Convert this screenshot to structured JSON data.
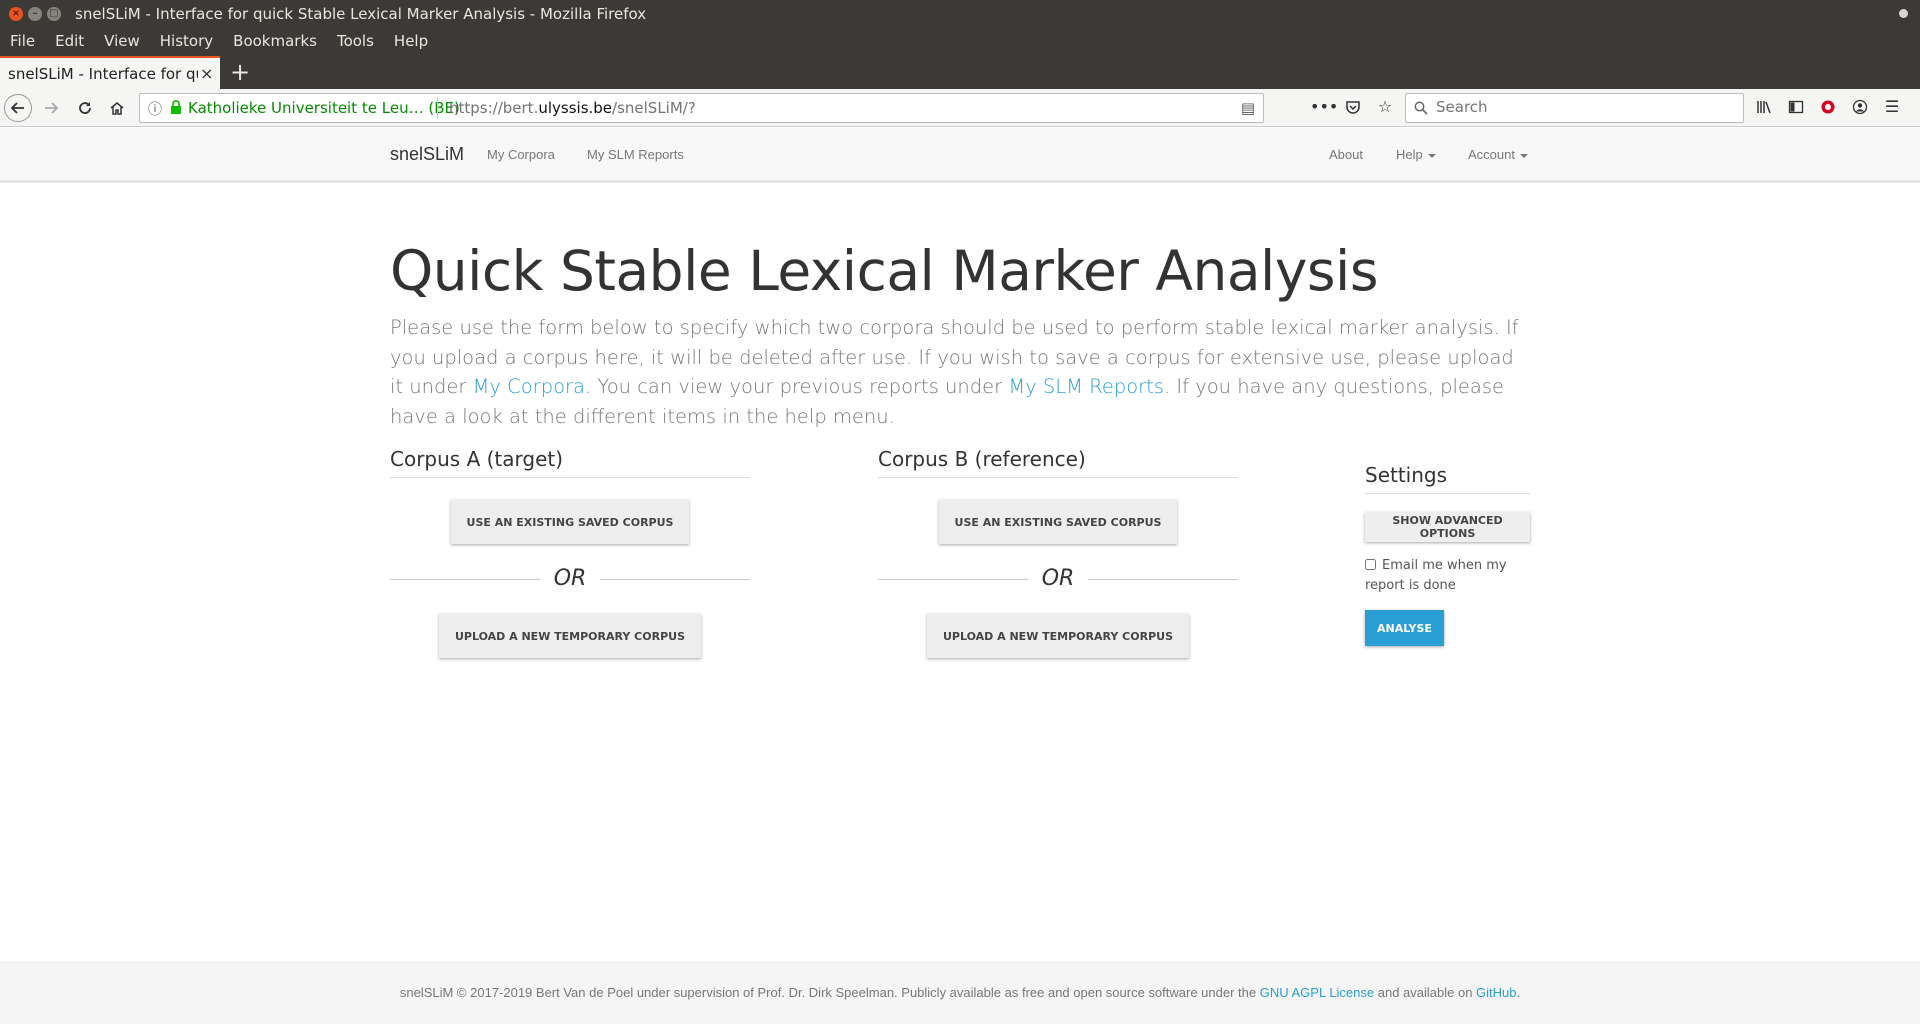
{
  "window": {
    "title": "snelSLiM - Interface for quick Stable Lexical Marker Analysis - Mozilla Firefox",
    "close_glyph": "×",
    "minimize_glyph": "–",
    "maximize_glyph": "□"
  },
  "menubar": {
    "items": [
      "File",
      "Edit",
      "View",
      "History",
      "Bookmarks",
      "Tools",
      "Help"
    ]
  },
  "tabs": {
    "active_title": "snelSLiM - Interface for quick Stable Lexical Marker Analysis",
    "close_glyph": "×",
    "new_tab_glyph": "+"
  },
  "navbar": {
    "site_identity": "Katholieke Universiteit te Leu…  (BE)",
    "url_prefix": "https://bert.",
    "url_host": "ulyssis.be",
    "url_path": "/snelSLiM/?",
    "search_placeholder": "Search",
    "icons": {
      "back": "back-arrow-icon",
      "forward": "forward-arrow-icon",
      "reload": "reload-icon",
      "home": "home-icon",
      "info": "info-icon",
      "lock": "lock-icon",
      "reader": "reader-view-icon",
      "more": "more-actions-icon",
      "pocket": "pocket-icon",
      "bookmark": "bookmark-star-icon",
      "search": "search-icon",
      "library": "library-icon",
      "sidebar": "sidebar-icon",
      "extension": "extension-icon",
      "account": "account-icon",
      "menu": "hamburger-menu-icon"
    }
  },
  "site_nav": {
    "brand": "snelSLiM",
    "links_left": [
      "My Corpora",
      "My SLM Reports"
    ],
    "links_right": {
      "about": "About",
      "help": "Help",
      "account": "Account"
    }
  },
  "main": {
    "heading": "Quick Stable Lexical Marker Analysis",
    "lead_part1": "Please use the form below to specify which two corpora should be used to perform stable lexical marker analysis. If you upload a corpus here, it will be deleted after use. If you wish to save a corpus for extensive use, please upload it under ",
    "lead_link1": "My Corpora",
    "lead_part2": ". You can view your previous reports under ",
    "lead_link2": "My SLM Reports",
    "lead_part3": ". If you have any questions, please have a look at the different items in the help menu.",
    "corpus_a": {
      "title": "Corpus A (target)",
      "existing_button": "Use an existing saved corpus",
      "or_text": "OR",
      "upload_button": "Upload a new temporary corpus"
    },
    "corpus_b": {
      "title": "Corpus B (reference)",
      "existing_button": "Use an existing saved corpus",
      "or_text": "OR",
      "upload_button": "Upload a new temporary corpus"
    },
    "settings": {
      "title": "Settings",
      "advanced_button": "Show advanced options",
      "email_label": "Email me when my report is done",
      "email_checked": false,
      "analyse_button": "Analyse"
    }
  },
  "footer": {
    "text_part1": "snelSLiM © 2017-2019 Bert Van de Poel under supervision of Prof. Dr. Dirk Speelman. Publicly available as free and open source software under the ",
    "license_link": "GNU AGPL License",
    "text_part2": " and available on ",
    "github_link": "GitHub",
    "text_part3": "."
  }
}
